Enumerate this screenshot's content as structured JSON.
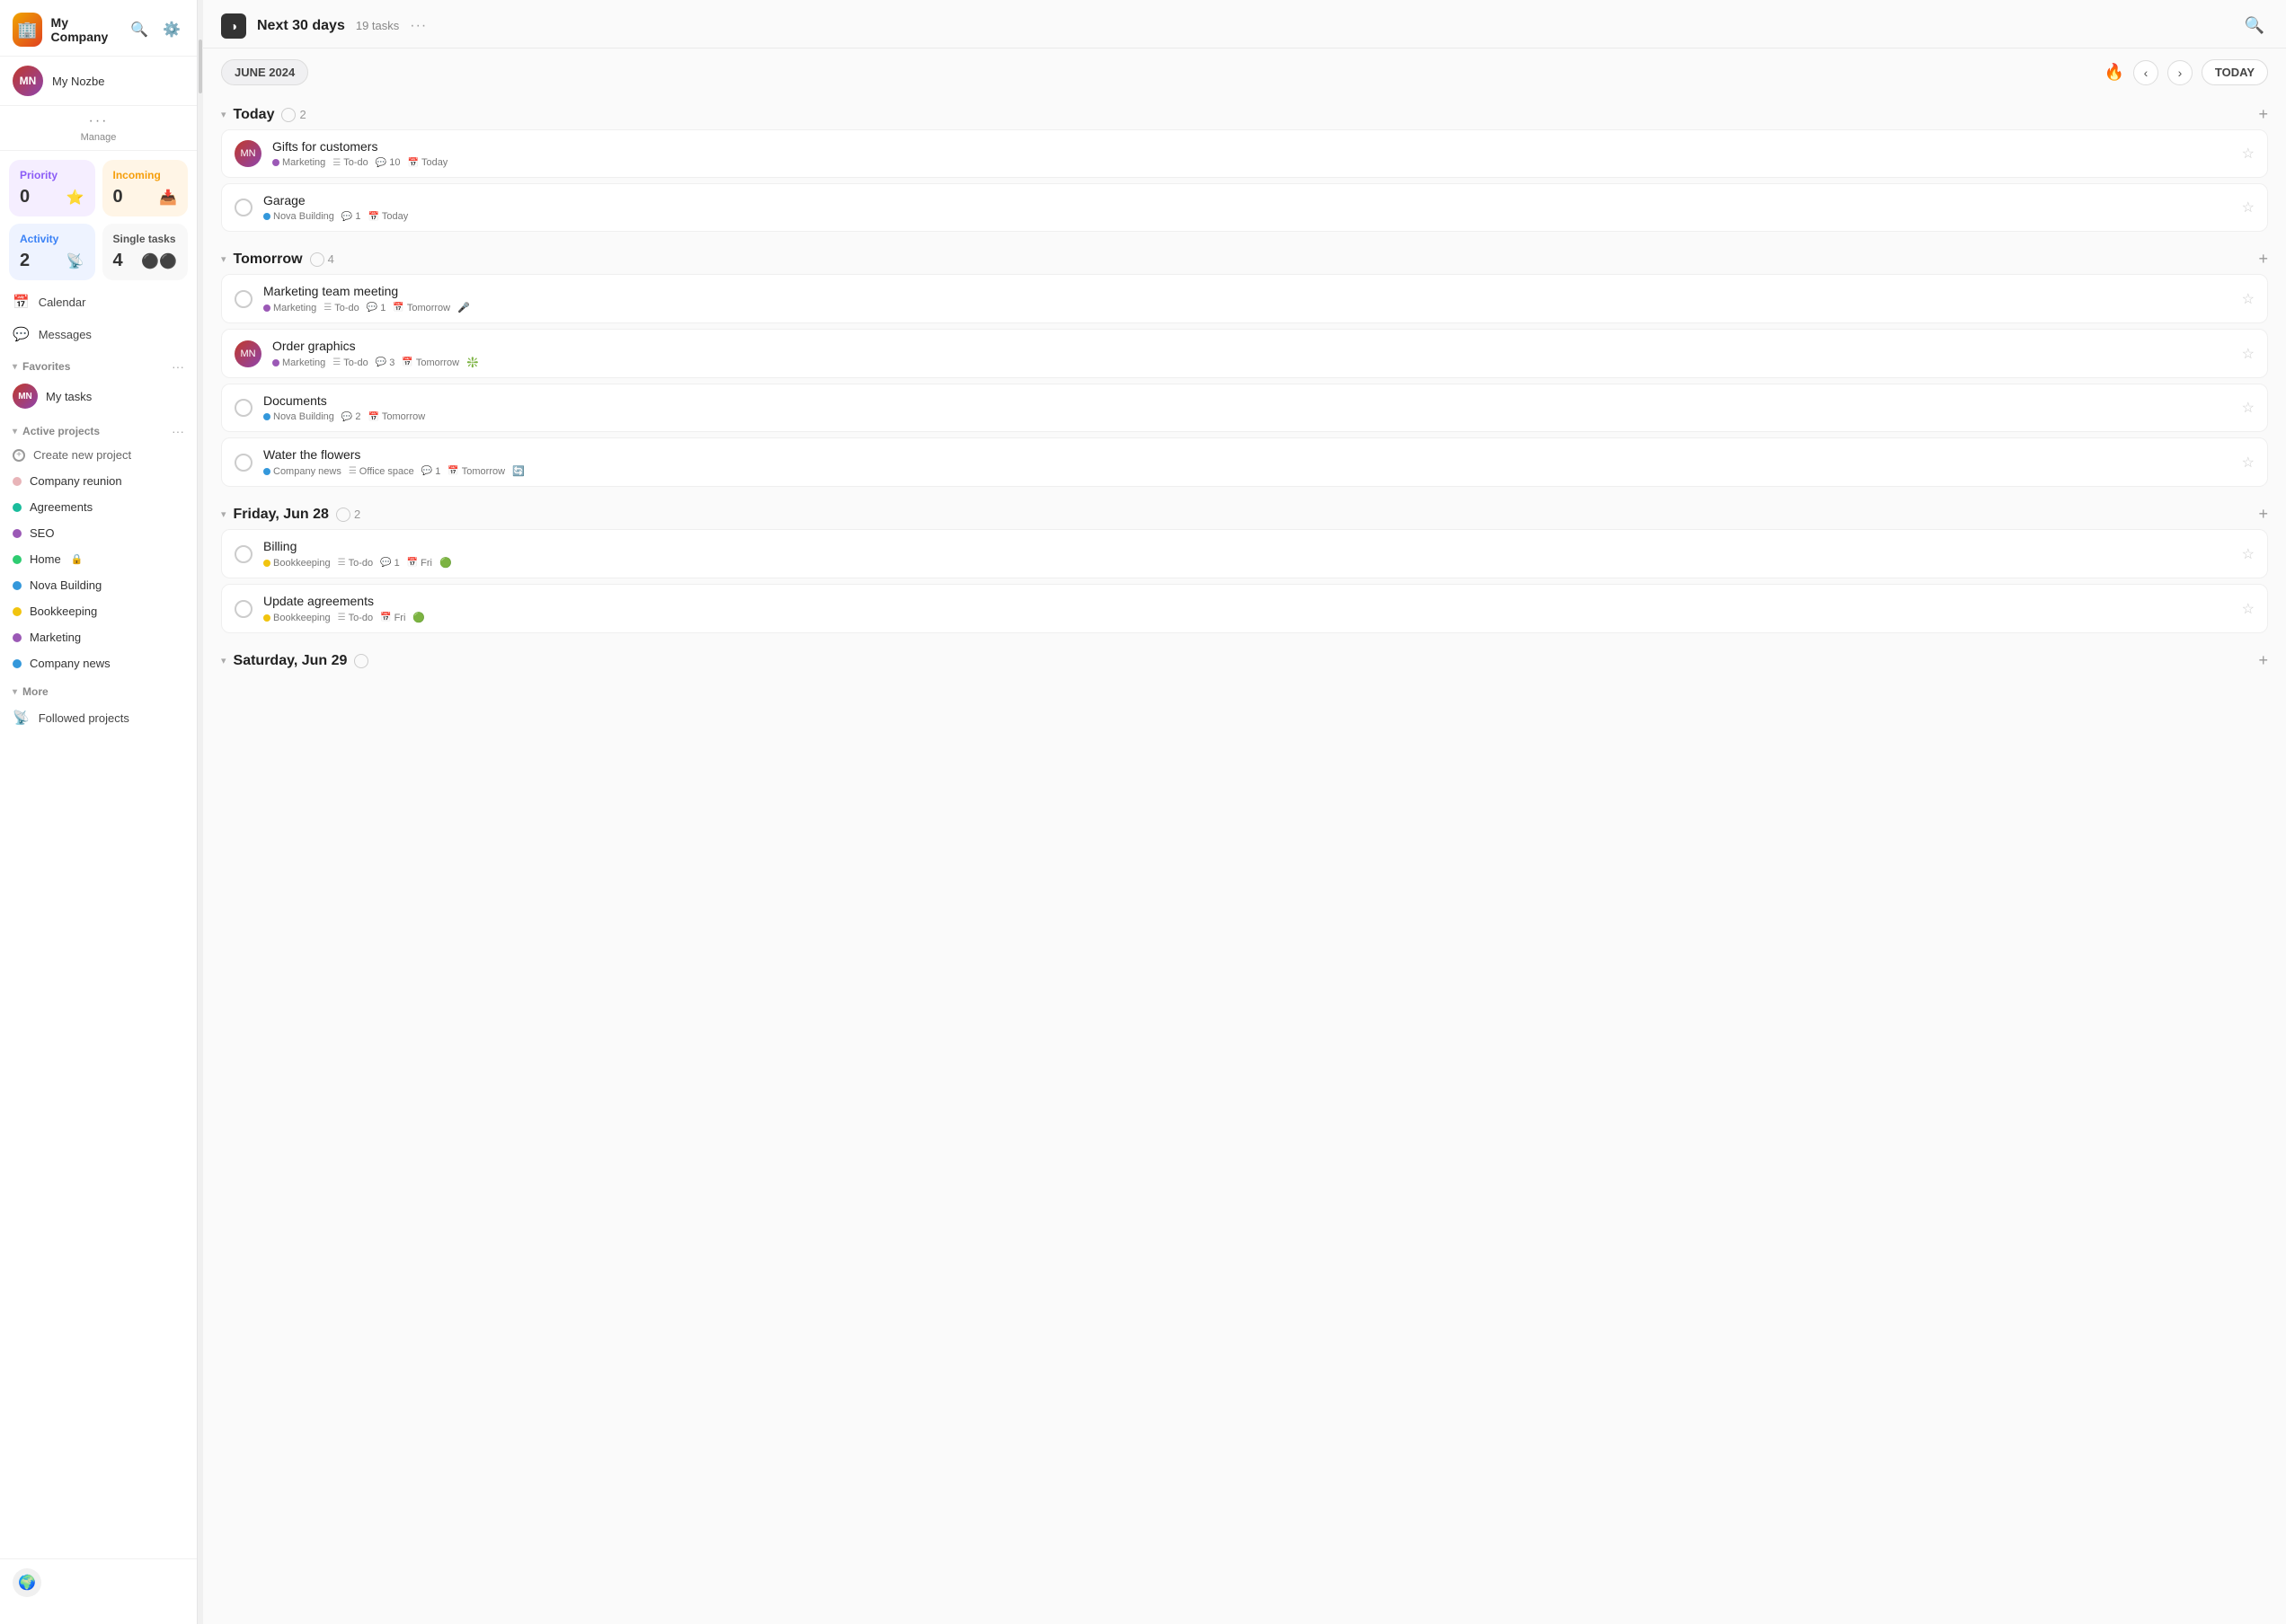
{
  "sidebar": {
    "company_name": "My Company",
    "user_name": "My Nozbe",
    "manage_label": "Manage",
    "stats": {
      "priority": {
        "label": "Priority",
        "value": "0",
        "icon": "⭐"
      },
      "incoming": {
        "label": "Incoming",
        "value": "0",
        "icon": "📥"
      },
      "activity": {
        "label": "Activity",
        "value": "2",
        "icon": "📡"
      },
      "single": {
        "label": "Single tasks",
        "value": "4",
        "icon": "⚫"
      }
    },
    "nav": [
      {
        "label": "Calendar",
        "icon": "📅"
      },
      {
        "label": "Messages",
        "icon": "💬"
      }
    ],
    "favorites_label": "Favorites",
    "my_tasks_label": "My tasks",
    "active_projects_label": "Active projects",
    "create_project_label": "Create new project",
    "projects": [
      {
        "name": "Company reunion",
        "color": "#e8b4b8"
      },
      {
        "name": "Agreements",
        "color": "#1abc9c"
      },
      {
        "name": "SEO",
        "color": "#9b59b6"
      },
      {
        "name": "Home",
        "color": "#2ecc71",
        "locked": true
      },
      {
        "name": "Nova Building",
        "color": "#3498db"
      },
      {
        "name": "Bookkeeping",
        "color": "#f1c40f"
      },
      {
        "name": "Marketing",
        "color": "#9b59b6"
      },
      {
        "name": "Company news",
        "color": "#3498db"
      }
    ],
    "more_label": "More",
    "followed_projects_label": "Followed projects"
  },
  "topbar": {
    "title": "Next 30 days",
    "task_count": "19 tasks",
    "dots": "···",
    "search_icon": "🔍"
  },
  "date_nav": {
    "current_date": "JUNE 2024",
    "fire_icon": "🔥",
    "today_label": "TODAY"
  },
  "task_groups": [
    {
      "id": "today",
      "title": "Today",
      "count": "2",
      "tasks": [
        {
          "id": "t1",
          "title": "Gifts for customers",
          "project": "Marketing",
          "project_color": "#9b59b6",
          "list": "To-do",
          "comments": "10",
          "date": "Today",
          "has_avatar": true,
          "priority_icon": ""
        },
        {
          "id": "t2",
          "title": "Garage",
          "project": "Nova Building",
          "project_color": "#3498db",
          "list": "",
          "comments": "1",
          "date": "Today",
          "has_avatar": false,
          "priority_icon": ""
        }
      ]
    },
    {
      "id": "tomorrow",
      "title": "Tomorrow",
      "count": "4",
      "tasks": [
        {
          "id": "t3",
          "title": "Marketing team meeting",
          "project": "Marketing",
          "project_color": "#9b59b6",
          "list": "To-do",
          "comments": "1",
          "date": "Tomorrow",
          "has_avatar": false,
          "priority_icon": "🎤"
        },
        {
          "id": "t4",
          "title": "Order graphics",
          "project": "Marketing",
          "project_color": "#9b59b6",
          "list": "To-do",
          "comments": "3",
          "date": "Tomorrow",
          "has_avatar": true,
          "priority_icon": "❇️"
        },
        {
          "id": "t5",
          "title": "Documents",
          "project": "Nova Building",
          "project_color": "#3498db",
          "list": "",
          "comments": "2",
          "date": "Tomorrow",
          "has_avatar": false,
          "priority_icon": ""
        },
        {
          "id": "t6",
          "title": "Water the flowers",
          "project": "Company news",
          "project_color": "#3498db",
          "list": "Office space",
          "comments": "1",
          "date": "Tomorrow",
          "has_avatar": false,
          "priority_icon": "🔄"
        }
      ]
    },
    {
      "id": "friday",
      "title": "Friday, Jun 28",
      "count": "2",
      "tasks": [
        {
          "id": "t7",
          "title": "Billing",
          "project": "Bookkeeping",
          "project_color": "#f1c40f",
          "list": "To-do",
          "comments": "1",
          "date": "Fri",
          "has_avatar": false,
          "priority_icon": "🟢"
        },
        {
          "id": "t8",
          "title": "Update agreements",
          "project": "Bookkeeping",
          "project_color": "#f1c40f",
          "list": "To-do",
          "comments": "",
          "date": "Fri",
          "has_avatar": false,
          "priority_icon": "🟢"
        }
      ]
    },
    {
      "id": "saturday",
      "title": "Saturday, Jun 29",
      "count": "",
      "tasks": []
    }
  ]
}
